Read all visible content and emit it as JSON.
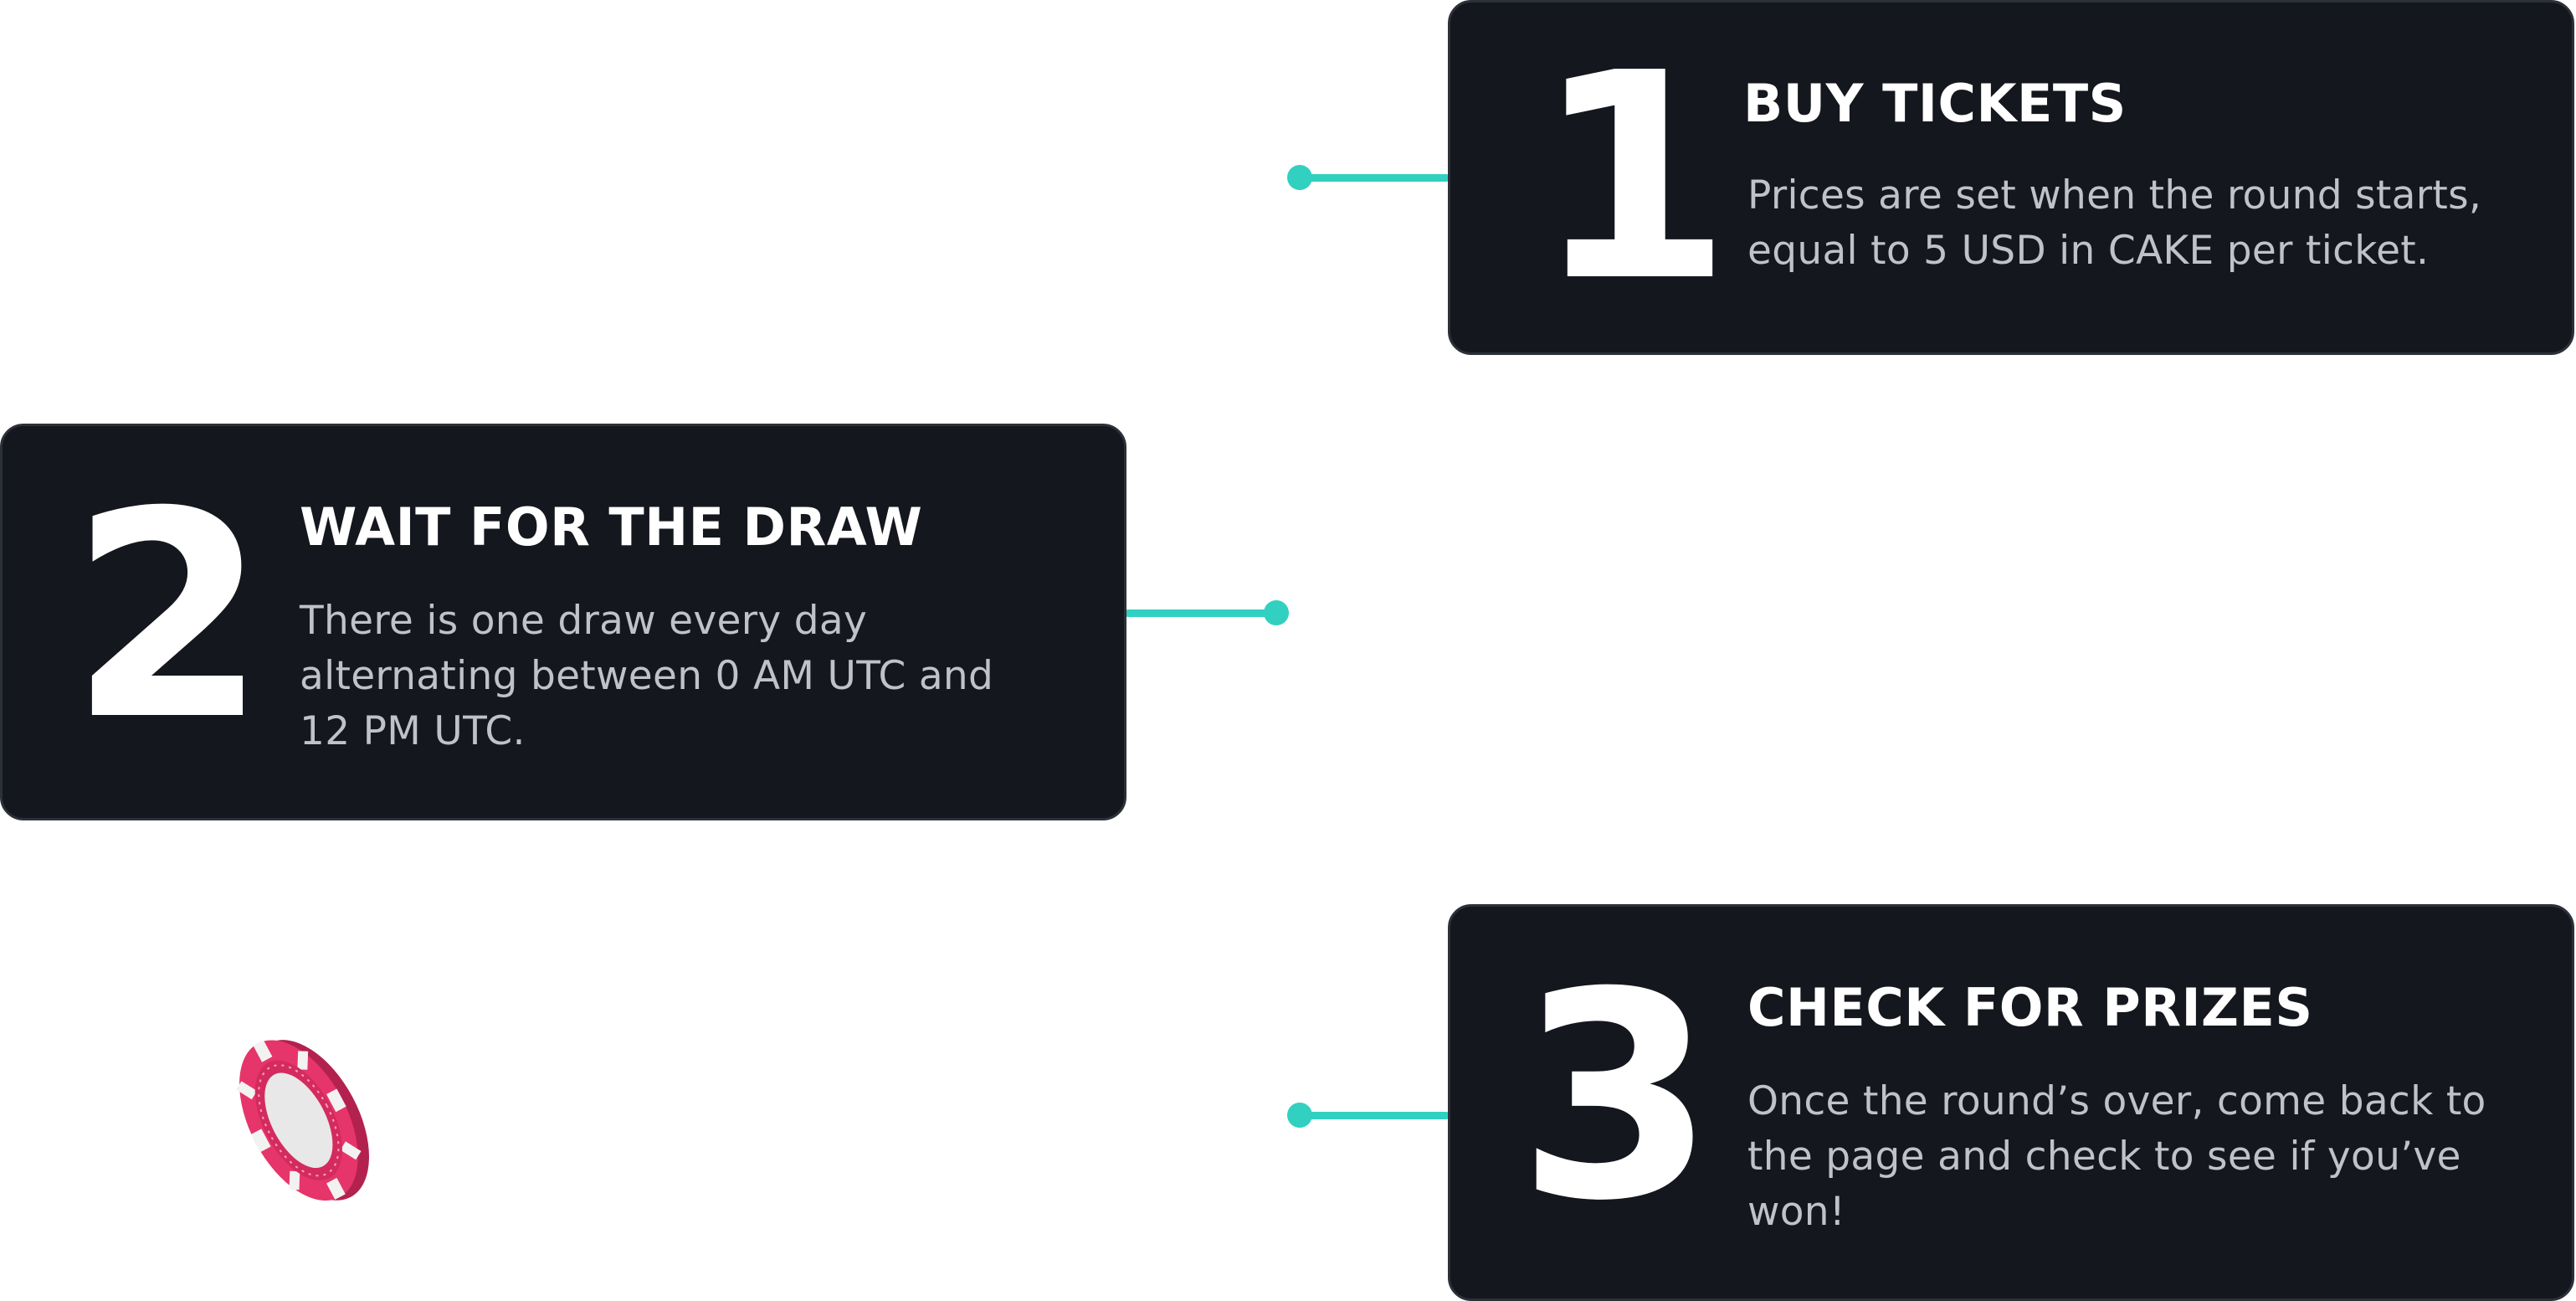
{
  "steps": [
    {
      "number": "1",
      "title": "BUY TICKETS",
      "description": "Prices are set when the round starts, equal to 5 USD in CAKE per ticket."
    },
    {
      "number": "2",
      "title": "WAIT FOR THE DRAW",
      "description": "There is one draw every day alternating between 0 AM UTC and 12 PM UTC."
    },
    {
      "number": "3",
      "title": "CHECK FOR PRIZES",
      "description": "Once the round’s over, come back to the page and check to see if you’ve won!"
    }
  ],
  "colors": {
    "card_background": "#14171d",
    "connector": "#31d0c0",
    "chip_red": "#e6356a",
    "chip_white": "#e8e8e8"
  },
  "icons": {
    "chip": "poker-chip-icon"
  }
}
